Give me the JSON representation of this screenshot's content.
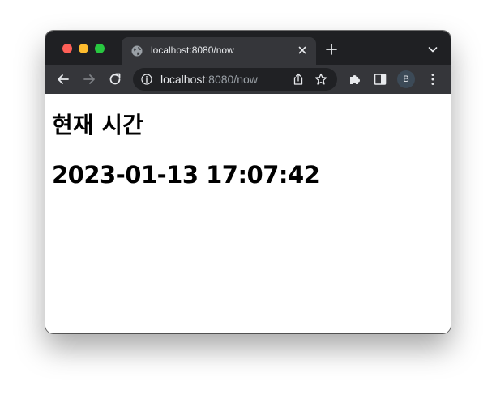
{
  "browser": {
    "tab_title": "localhost:8080/now",
    "url_host": "localhost",
    "url_rest": ":8080/now",
    "avatar_initial": "B",
    "icons": {
      "favicon": "globe-icon",
      "tab_close": "close-icon",
      "new_tab": "plus-icon",
      "tab_search": "chevron-down-icon",
      "back": "back-arrow-icon",
      "forward": "forward-arrow-icon",
      "reload": "reload-icon",
      "site_info": "info-icon",
      "share": "share-icon",
      "bookmark": "star-icon",
      "extensions": "puzzle-icon",
      "side_panel": "side-panel-icon",
      "menu": "kebab-menu-icon"
    },
    "colors": {
      "tab_strip": "#1f2023",
      "toolbar": "#35363a",
      "omnibox": "#202124",
      "traffic_red": "#fe5f57",
      "traffic_yellow": "#febc2e",
      "traffic_green": "#28c840"
    }
  },
  "page": {
    "title": "현재 시간",
    "time": "2023-01-13 17:07:42"
  }
}
